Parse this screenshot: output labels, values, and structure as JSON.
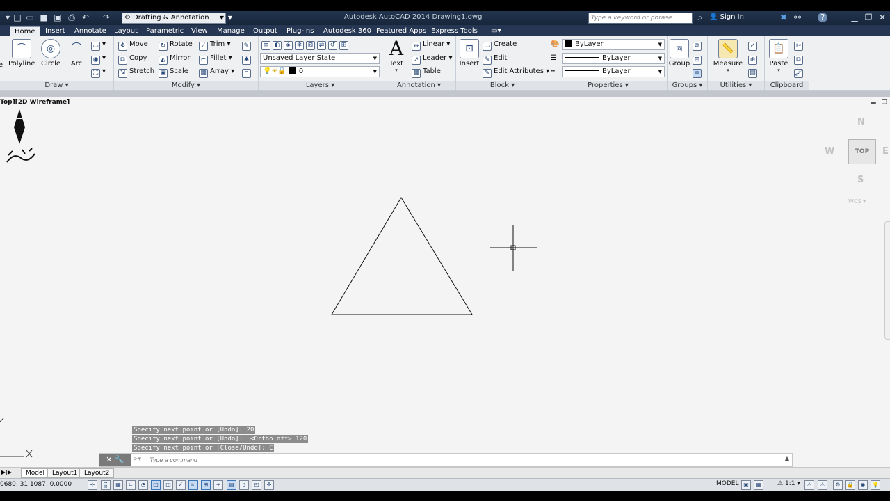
{
  "app": {
    "title": "Autodesk AutoCAD 2014    Drawing1.dwg"
  },
  "workspace": "Drafting & Annotation",
  "search": {
    "placeholder": "Type a keyword or phrase"
  },
  "signin": "Sign In",
  "tabs": [
    "Home",
    "Insert",
    "Annotate",
    "Layout",
    "Parametric",
    "View",
    "Manage",
    "Output",
    "Plug-ins",
    "Autodesk 360",
    "Featured Apps",
    "Express Tools"
  ],
  "ribbon": {
    "draw": {
      "title": "Draw",
      "polyline": "Polyline",
      "circle": "Circle",
      "arc": "Arc",
      "line_partial": "e"
    },
    "modify": {
      "title": "Modify",
      "move": "Move",
      "rotate": "Rotate",
      "trim": "Trim",
      "copy": "Copy",
      "mirror": "Mirror",
      "fillet": "Fillet",
      "stretch": "Stretch",
      "scale": "Scale",
      "array": "Array"
    },
    "layers": {
      "title": "Layers",
      "layer_state": "Unsaved Layer State",
      "current_layer": "0"
    },
    "annotation": {
      "title": "Annotation",
      "text": "Text",
      "linear": "Linear",
      "leader": "Leader",
      "table": "Table"
    },
    "block": {
      "title": "Block",
      "insert": "Insert",
      "create": "Create",
      "edit": "Edit",
      "edit_attributes": "Edit Attributes"
    },
    "properties": {
      "title": "Properties",
      "color": "ByLayer",
      "linetype": "ByLayer",
      "lineweight": "ByLayer"
    },
    "groups": {
      "title": "Groups",
      "group": "Group"
    },
    "utilities": {
      "title": "Utilities",
      "measure": "Measure"
    },
    "clipboard": {
      "title": "Clipboard",
      "paste": "Paste"
    }
  },
  "viewport": {
    "label": "Top][2D Wireframe]"
  },
  "viewcube": {
    "north": "N",
    "south": "S",
    "west": "W",
    "east": "E",
    "top": "TOP",
    "wcs": "WCS"
  },
  "command": {
    "history": [
      "Specify next point or [Undo]: 20",
      "Specify next point or [Undo]:  <Ortho off> 120",
      "Specify next point or [Close/Undo]: C"
    ],
    "placeholder": "Type a command"
  },
  "layouts": [
    "Model",
    "Layout1",
    "Layout2"
  ],
  "status": {
    "coords": "0680, 31.1087, 0.0000",
    "model": "MODEL",
    "annotation_scale": "1:1"
  },
  "colors": {
    "canvas": "#f4f4f4",
    "ribbon_dark": "#263754"
  },
  "logo": {
    "text": "نشر آفرنگ"
  }
}
